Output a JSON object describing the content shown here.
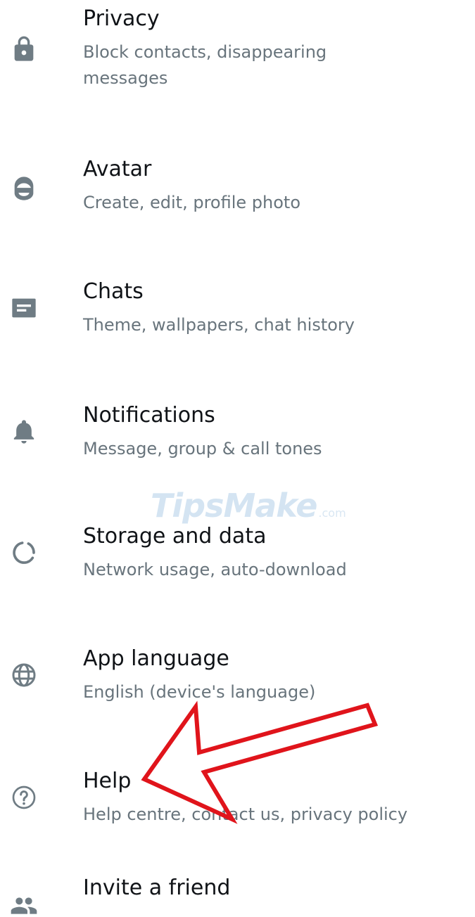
{
  "settings": {
    "items": [
      {
        "title": "Privacy",
        "subtitle": "Block contacts, disappearing messages",
        "icon": "lock-icon"
      },
      {
        "title": "Avatar",
        "subtitle": "Create, edit, profile photo",
        "icon": "avatar-icon"
      },
      {
        "title": "Chats",
        "subtitle": "Theme, wallpapers, chat history",
        "icon": "chat-icon"
      },
      {
        "title": "Notifications",
        "subtitle": "Message, group & call tones",
        "icon": "bell-icon"
      },
      {
        "title": "Storage and data",
        "subtitle": "Network usage, auto-download",
        "icon": "storage-circle-icon"
      },
      {
        "title": "App language",
        "subtitle": "English (device's language)",
        "icon": "globe-icon"
      },
      {
        "title": "Help",
        "subtitle": "Help centre, contact us, privacy policy",
        "icon": "help-circle-icon"
      },
      {
        "title": "Invite a friend",
        "subtitle": "",
        "icon": "people-icon"
      }
    ]
  },
  "watermark": {
    "text": "TipsMake",
    "suffix": ".com"
  },
  "annotation": {
    "type": "red-arrow",
    "points_to": "Help",
    "color": "#e0141b"
  },
  "colors": {
    "icon": "#6f7c84",
    "title": "#101317",
    "subtitle": "#68747c",
    "background": "#ffffff"
  }
}
